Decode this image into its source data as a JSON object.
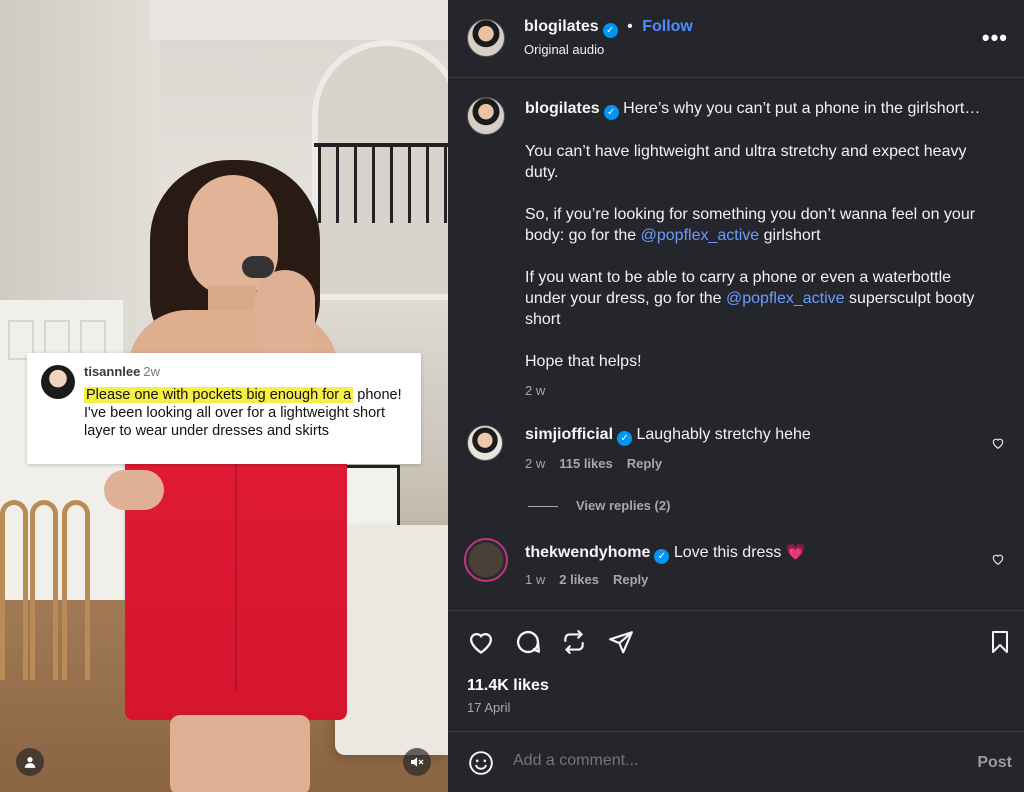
{
  "video": {
    "overlay_comment": {
      "username": "tisannlee",
      "time": "2w",
      "highlight": "Please one with pockets big enough for a",
      "text": "phone! I've been looking all over for a lightweight short layer to wear under dresses and skirts"
    }
  },
  "header": {
    "username": "blogilates",
    "separator": "•",
    "follow_label": "Follow",
    "audio": "Original audio",
    "more_label": "•••"
  },
  "caption": {
    "username": "blogilates",
    "line1": "Here’s why you can’t put a phone in the girlshort…",
    "p2": "You can’t have lightweight and ultra stretchy and expect heavy duty.",
    "p3_a": "So, if you’re looking for something you don’t wanna feel on your body: go for the",
    "p3_mention": "@popflex_active",
    "p3_b": "girlshort",
    "p4_a": "If you want to be able to carry a phone or even a waterbottle under your dress, go for the",
    "p4_mention": "@popflex_active",
    "p4_b": "supersculpt booty short",
    "p5": "Hope that helps!",
    "time": "2 w"
  },
  "comments": [
    {
      "username": "simjiofficial",
      "text": "Laughably stretchy hehe",
      "time": "2 w",
      "likes": "115 likes",
      "reply": "Reply"
    },
    {
      "username": "thekwendyhome",
      "text": "Love this dress",
      "emoji": "💗",
      "time": "1 w",
      "likes": "2 likes",
      "reply": "Reply"
    }
  ],
  "view_replies": "View replies (2)",
  "post_stats": {
    "likes": "11.4K likes",
    "date": "17 April"
  },
  "composer": {
    "placeholder": "Add a comment...",
    "post_label": "Post"
  },
  "colors": {
    "panel_bg": "#25262b",
    "link": "#4c8dff",
    "verified": "#0095f6",
    "dress": "#e31d36",
    "highlight": "#f6f046"
  },
  "icons": [
    "like-icon",
    "comment-icon",
    "share-icon",
    "send-icon",
    "save-icon",
    "emoji-icon",
    "mute-icon",
    "user-icon",
    "heart-icon",
    "verified-icon"
  ]
}
